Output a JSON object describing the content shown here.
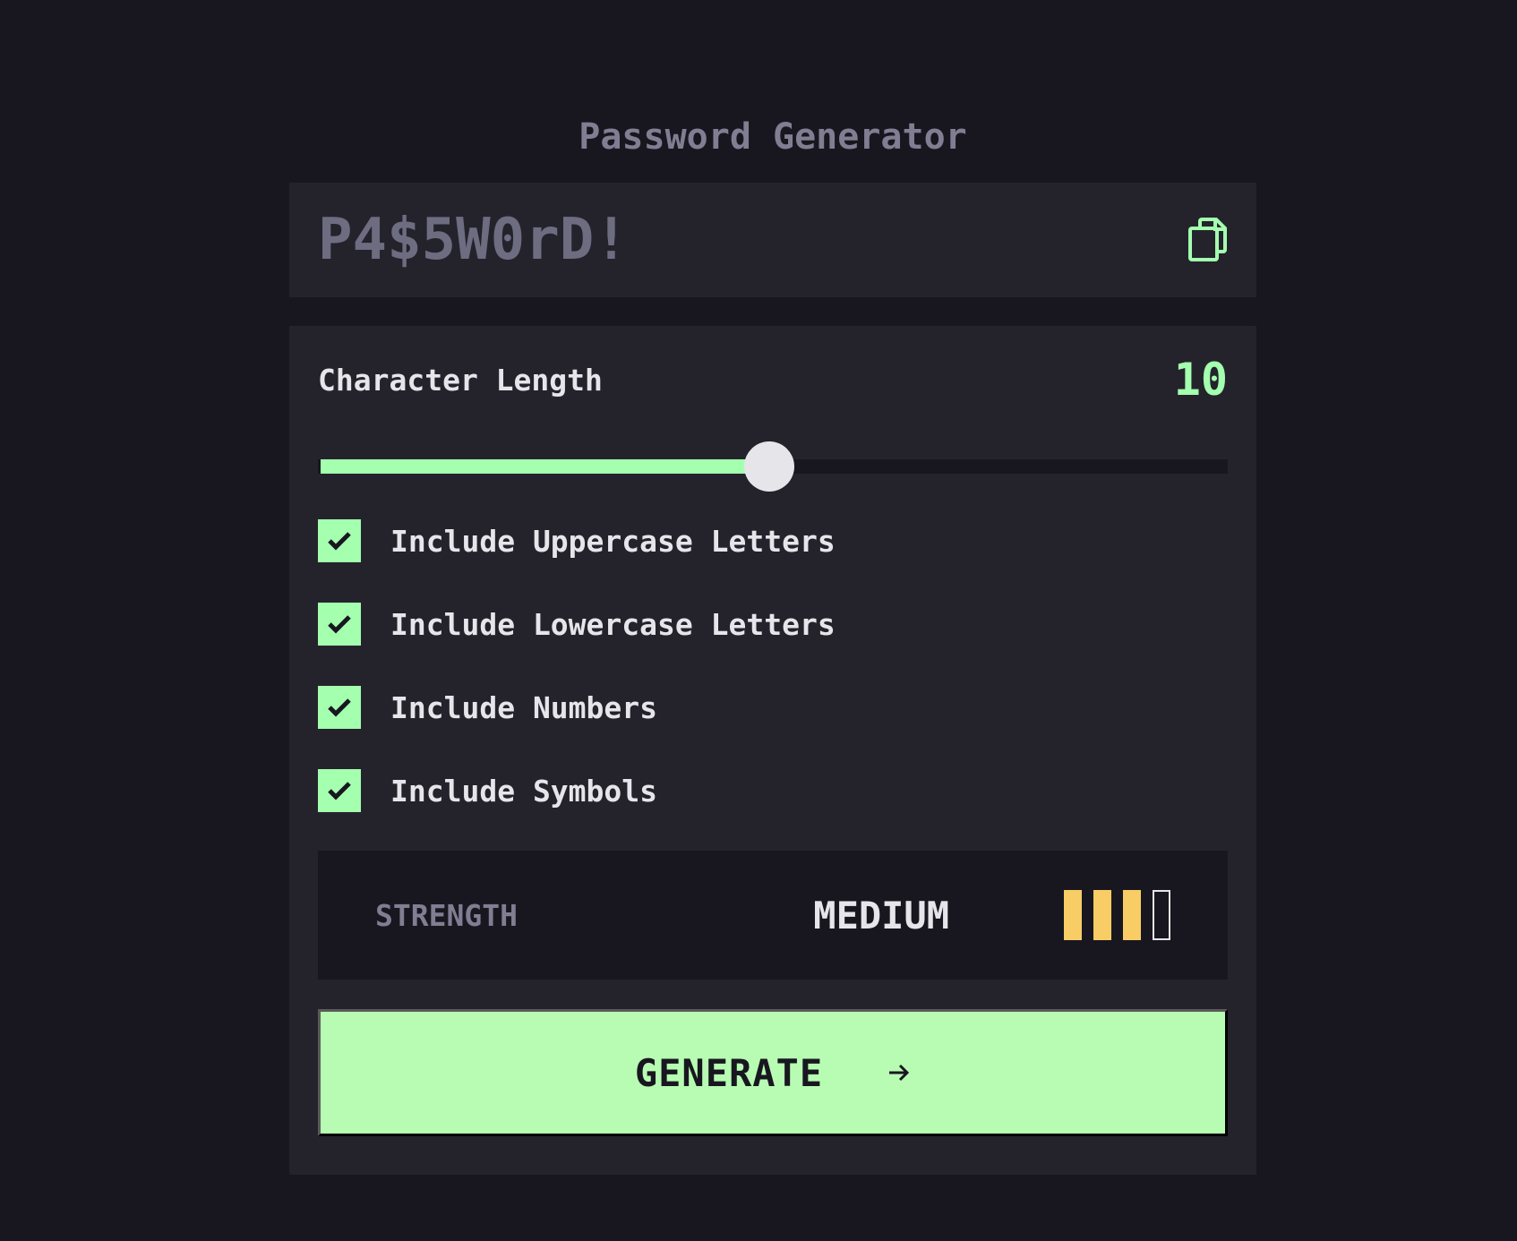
{
  "header": {
    "title": "Password Generator"
  },
  "password": {
    "value": "P4$5W0rD!",
    "copy_icon": "copy-icon"
  },
  "length": {
    "label": "Character Length",
    "value": "10",
    "slider_fraction": 0.5
  },
  "options": [
    {
      "label": "Include Uppercase Letters",
      "checked": true
    },
    {
      "label": "Include Lowercase Letters",
      "checked": true
    },
    {
      "label": "Include Numbers",
      "checked": true
    },
    {
      "label": "Include Symbols",
      "checked": true
    }
  ],
  "strength": {
    "label": "STRENGTH",
    "value": "MEDIUM",
    "level": 3,
    "max_level": 4
  },
  "generate": {
    "label": "GENERATE",
    "icon": "arrow-right-icon"
  },
  "colors": {
    "background": "#18171f",
    "panel": "#24232c",
    "accent": "#a4ffaf",
    "strength_medium": "#f8cd65",
    "text_light": "#e6e5ea",
    "text_muted": "#817d92"
  }
}
